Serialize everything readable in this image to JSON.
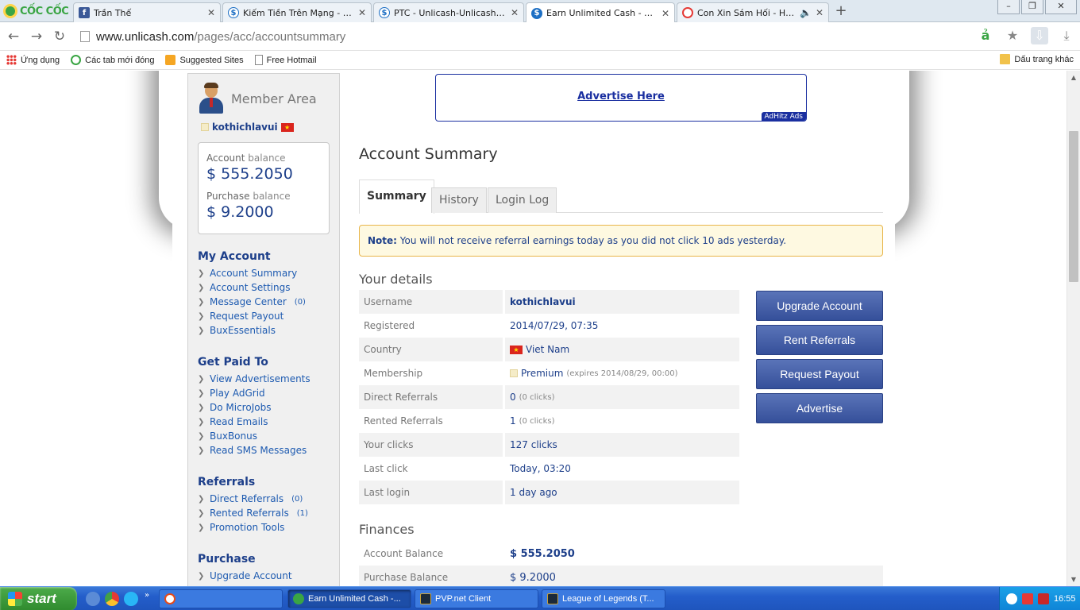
{
  "browser": {
    "brand": "CỐC CỐC",
    "tabs": [
      {
        "title": "Trần Thế",
        "favicon": "facebook-icon"
      },
      {
        "title": "Kiếm Tiền Trên Mạng - Make",
        "favicon": "unlicash-icon"
      },
      {
        "title": "PTC - Unlicash-Unlicash.com,",
        "favicon": "unlicash-icon"
      },
      {
        "title": "Earn Unlimited Cash - Earn ,",
        "favicon": "unlicash-icon"
      },
      {
        "title": "Con Xin Sám Hối - Hồ Qua",
        "favicon": "youtube-icon"
      }
    ],
    "url_host": "www.unlicash.com",
    "url_path": "/pages/acc/accountsummary",
    "bookmarks": [
      "Ứng dụng",
      "Các tab mới đóng",
      "Suggested Sites",
      "Free Hotmail"
    ],
    "bookmarks_right": "Dấu trang khác"
  },
  "ad": {
    "link": "Advertise Here",
    "tag": "AdHitz Ads"
  },
  "sidebar": {
    "member_title": "Member Area",
    "username": "kothichlavui",
    "account_balance_label": "Account",
    "account_balance_label2": "balance",
    "account_balance": "$ 555.2050",
    "purchase_balance_label": "Purchase",
    "purchase_balance_label2": "balance",
    "purchase_balance": "$ 9.2000",
    "sections": {
      "my_account": {
        "heading": "My Account",
        "items": [
          "Account Summary",
          "Account Settings",
          "Message Center",
          "Request Payout",
          "BuxEssentials"
        ],
        "message_count": "(0)"
      },
      "get_paid": {
        "heading": "Get Paid To",
        "items": [
          "View Advertisements",
          "Play AdGrid",
          "Do MicroJobs",
          "Read Emails",
          "BuxBonus",
          "Read SMS Messages"
        ]
      },
      "referrals": {
        "heading": "Referrals",
        "items": [
          "Direct Referrals",
          "Rented Referrals",
          "Promotion Tools"
        ],
        "direct_count": "(0)",
        "rented_count": "(1)"
      },
      "purchase": {
        "heading": "Purchase",
        "items": [
          "Upgrade Account"
        ]
      }
    }
  },
  "main": {
    "title": "Account Summary",
    "tabs": [
      "Summary",
      "History",
      "Login Log"
    ],
    "note_label": "Note:",
    "note_text": "You will not receive referral earnings today as you did not click 10 ads yesterday.",
    "details_title": "Your details",
    "details": [
      {
        "label": "Username",
        "value": "kothichlavui"
      },
      {
        "label": "Registered",
        "value": "2014/07/29, 07:35"
      },
      {
        "label": "Country",
        "value": "Viet Nam"
      },
      {
        "label": "Membership",
        "value": "Premium",
        "extra": "(expires 2014/08/29, 00:00)"
      },
      {
        "label": "Direct Referrals",
        "value": "0",
        "extra": "(0 clicks)"
      },
      {
        "label": "Rented Referrals",
        "value": "1",
        "extra": "(0 clicks)"
      },
      {
        "label": "Your clicks",
        "value": "127 clicks"
      },
      {
        "label": "Last click",
        "value": "Today, 03:20"
      },
      {
        "label": "Last login",
        "value": "1 day ago"
      }
    ],
    "actions": [
      "Upgrade Account",
      "Rent Referrals",
      "Request Payout",
      "Advertise"
    ],
    "finances_title": "Finances",
    "finances": [
      {
        "label": "Account Balance",
        "value": "$ 555.2050"
      },
      {
        "label": "Purchase Balance",
        "value": "$ 9.2000"
      }
    ]
  },
  "taskbar": {
    "start": "start",
    "tasks": [
      "Earn Unlimited Cash -...",
      "PVP.net Client",
      "League of Legends (T..."
    ],
    "clock": "16:55"
  }
}
